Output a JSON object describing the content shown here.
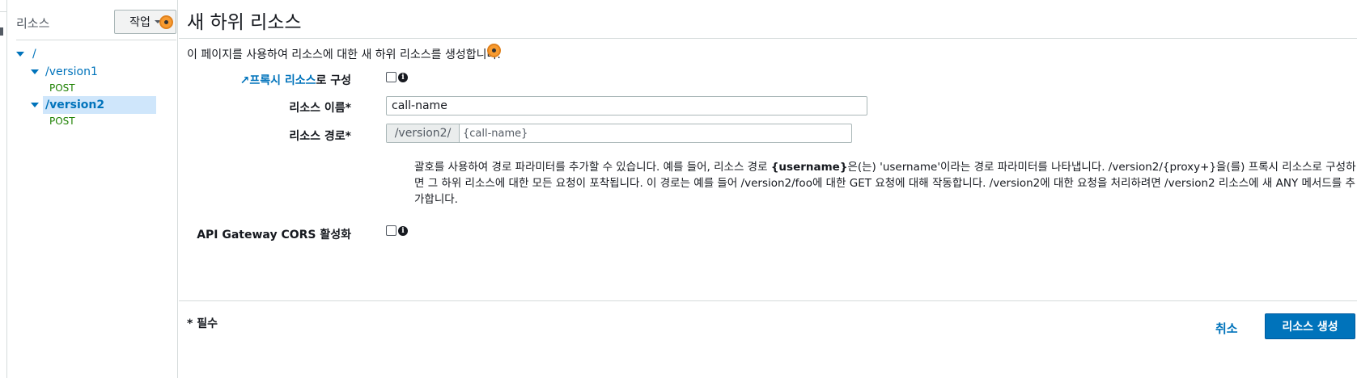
{
  "sidebar": {
    "title": "리소스",
    "actions_label": "작업",
    "tree": [
      {
        "label": "/"
      },
      {
        "label": "/version1",
        "method": "POST"
      },
      {
        "label": "/version2",
        "method": "POST"
      }
    ]
  },
  "main": {
    "title": "새 하위 리소스",
    "description": "이 페이지를 사용하여 리소스에 대한 새 하위 리소스를 생성합니다.",
    "proxy_label_link": "프록시 리소스",
    "proxy_label_suffix": "로 구성",
    "resource_name_label": "리소스 이름*",
    "resource_name_value": "call-name",
    "resource_path_label": "리소스 경로*",
    "resource_path_prefix": "/version2/",
    "resource_path_value": "{call-name}",
    "help_1": "괄호를 사용하여 경로 파라미터를 추가할 수 있습니다. 예를 들어, 리소스 경로 ",
    "help_bold": "{username}",
    "help_2": "은(는) 'username'이라는 경로 파라미터를 나타냅니다. /version2/{proxy+}을(를) 프록시 리소스로 구성하면 그 하위 리소스에 대한 모든 요청이 포착됩니다. 이 경로는 예를 들어 /version2/foo에 대한 GET 요청에 대해 작동합니다. /version2에 대한 요청을 처리하려면 /version2 리소스에 새 ANY 메서드를 추가합니다.",
    "cors_label": "API Gateway CORS 활성화",
    "required_note": "* 필수",
    "cancel_label": "취소",
    "create_label": "리소스 생성"
  }
}
